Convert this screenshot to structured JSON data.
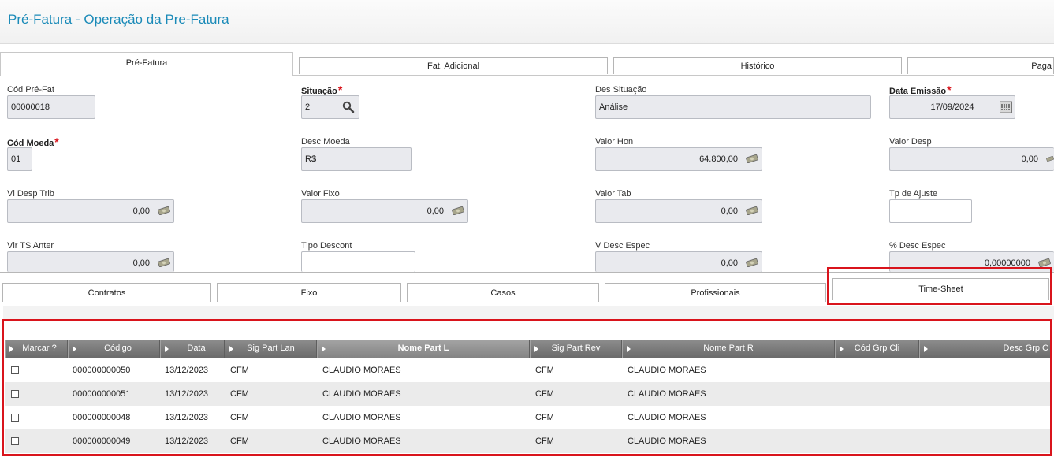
{
  "header": {
    "title": "Pré-Fatura - Operação da Pre-Fatura"
  },
  "top_tabs": [
    {
      "label": "Pré-Fatura"
    },
    {
      "label": "Fat. Adicional"
    },
    {
      "label": "Histórico"
    },
    {
      "label": "Paga"
    }
  ],
  "form": {
    "cod_pre_fat": {
      "label": "Cód Pré-Fat",
      "value": "00000018"
    },
    "situacao": {
      "label": "Situação",
      "value": "2"
    },
    "des_situacao": {
      "label": "Des Situação",
      "value": "Análise"
    },
    "data_emissao": {
      "label": "Data Emissão",
      "value": "17/09/2024"
    },
    "cod_moeda": {
      "label": "Cód Moeda",
      "value": "01"
    },
    "desc_moeda": {
      "label": "Desc Moeda",
      "value": "R$"
    },
    "valor_hon": {
      "label": "Valor Hon",
      "value": "64.800,00"
    },
    "valor_desp": {
      "label": "Valor Desp",
      "value": "0,00"
    },
    "vl_desp_trib": {
      "label": "Vl Desp Trib",
      "value": "0,00"
    },
    "valor_fixo": {
      "label": "Valor Fixo",
      "value": "0,00"
    },
    "valor_tab": {
      "label": "Valor Tab",
      "value": "0,00"
    },
    "tp_ajuste": {
      "label": "Tp de Ajuste",
      "value": ""
    },
    "vlr_ts_anter": {
      "label": "Vlr TS Anter",
      "value": "0,00"
    },
    "tipo_descont": {
      "label": "Tipo Descont",
      "value": ""
    },
    "v_desc_espec": {
      "label": "V Desc Espec",
      "value": "0,00"
    },
    "pct_desc_espec": {
      "label": "% Desc Espec",
      "value": "0,00000000"
    },
    "required_mark": "*"
  },
  "bottom_tabs": [
    {
      "label": "Contratos"
    },
    {
      "label": "Fixo"
    },
    {
      "label": "Casos"
    },
    {
      "label": "Profissionais"
    },
    {
      "label": "Time-Sheet"
    }
  ],
  "grid": {
    "columns": [
      "Marcar ?",
      "Código",
      "Data",
      "Sig Part Lan",
      "Nome Part L",
      "Sig Part Rev",
      "Nome Part R",
      "Cód Grp Cli",
      "Desc Grp C"
    ],
    "rows": [
      {
        "codigo": "000000000050",
        "data": "13/12/2023",
        "sig_lan": "CFM",
        "nome_l": "CLAUDIO MORAES",
        "sig_rev": "CFM",
        "nome_r": "CLAUDIO MORAES"
      },
      {
        "codigo": "000000000051",
        "data": "13/12/2023",
        "sig_lan": "CFM",
        "nome_l": "CLAUDIO MORAES",
        "sig_rev": "CFM",
        "nome_r": "CLAUDIO MORAES"
      },
      {
        "codigo": "000000000048",
        "data": "13/12/2023",
        "sig_lan": "CFM",
        "nome_l": "CLAUDIO MORAES",
        "sig_rev": "CFM",
        "nome_r": "CLAUDIO MORAES"
      },
      {
        "codigo": "000000000049",
        "data": "13/12/2023",
        "sig_lan": "CFM",
        "nome_l": "CLAUDIO MORAES",
        "sig_rev": "CFM",
        "nome_r": "CLAUDIO MORAES"
      }
    ]
  },
  "colors": {
    "title": "#1a8ab8",
    "required": "#d9141c",
    "highlight": "#d9141c"
  }
}
